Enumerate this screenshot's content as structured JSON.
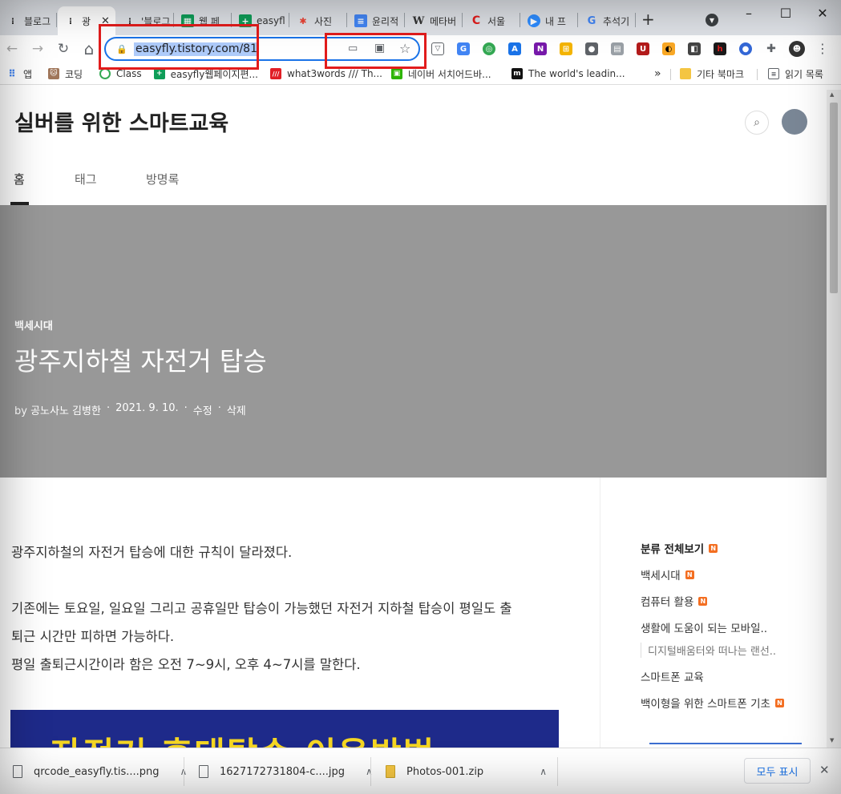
{
  "tabs": [
    {
      "label": "블로그",
      "icon": "tistory-icon"
    },
    {
      "label": "광",
      "icon": "tistory-icon",
      "active": true
    },
    {
      "label": "'블로그",
      "icon": "tistory-icon"
    },
    {
      "label": "웹 페",
      "icon": "sheet-icon"
    },
    {
      "label": "easyfl",
      "icon": "sheet-icon"
    },
    {
      "label": "사진",
      "icon": "photos-icon"
    },
    {
      "label": "윤리적",
      "icon": "docs-icon"
    },
    {
      "label": "메타버",
      "icon": "wikipedia-icon"
    },
    {
      "label": "서울",
      "icon": "red-c-icon"
    },
    {
      "label": "내 프",
      "icon": "zoom-icon"
    },
    {
      "label": "추석기",
      "icon": "google-icon"
    }
  ],
  "new_tab_label": "+",
  "window": {
    "minimize": "–",
    "maximize": "☐",
    "close": "✕"
  },
  "toolbar": {
    "back": "←",
    "forward": "→",
    "reload": "↻",
    "home": "⌂"
  },
  "omnibox": {
    "url": "easyfly.tistory.com/81"
  },
  "bookmarks": [
    {
      "label": "앱",
      "icon": "apps-icon"
    },
    {
      "label": "코딩",
      "icon": "cat-icon"
    },
    {
      "label": "Class",
      "icon": "class-icon"
    },
    {
      "label": "easyfly웹페이지편...",
      "icon": "sheet-icon"
    },
    {
      "label": "what3words /// Th...",
      "icon": "w3w-icon"
    },
    {
      "label": "네이버 서치어드바...",
      "icon": "naver-icon"
    },
    {
      "label": "The world's leadin...",
      "icon": "m-icon"
    }
  ],
  "bookmarks_more": "»",
  "bookmarks_other": "기타 북마크",
  "bookmarks_reading": "읽기 목록",
  "blog": {
    "title": "실버를 위한 스마트교육",
    "nav": [
      "홈",
      "태그",
      "방명록"
    ]
  },
  "post": {
    "category": "백세시대",
    "title": "광주지하철 자전거 탑승",
    "meta_by": "by 공노사노 김병한",
    "meta_date": "2021. 9. 10.",
    "meta_edit": "수정",
    "meta_delete": "삭제",
    "meta_sep": "·",
    "para1": "광주지하철의 자전거 탑승에 대한 규칙이 달라졌다.",
    "para2a": "기존에는 토요일, 일요일 그리고 공휴일만 탑승이 가능했던 자전거 지하철 탑승이 평일도 출",
    "para2b": "퇴근 시간만 피하면 가능하다.",
    "para3": "평일 출퇴근시간이라 함은 오전 7~9시, 오후 4~7시를 말한다.",
    "image_text": "자전거 휴대탑승 이용방법"
  },
  "sidebar": {
    "heading": "분류 전체보기",
    "items": [
      {
        "label": "백세시대",
        "new": true
      },
      {
        "label": "컴퓨터 활용",
        "new": true
      },
      {
        "label": "생활에 도움이 되는 모바일..",
        "new": false
      },
      {
        "label": "디지털배움터와 떠나는 랜선..",
        "new": false,
        "sub": true
      },
      {
        "label": "스마트폰 교육",
        "new": false
      },
      {
        "label": "백이형을 위한 스마트폰 기초",
        "new": true
      }
    ],
    "new_badge": "N"
  },
  "downloads": [
    {
      "file": "qrcode_easyfly.tis....png"
    },
    {
      "file": "1627172731804-c....jpg"
    },
    {
      "file": "Photos-001.zip"
    }
  ],
  "downloads_show_all": "모두 표시",
  "downloads_close": "✕",
  "colors": {
    "accent": "#1a73e8",
    "hero": "#989898",
    "badge": "#f36e21",
    "highlight": "#e21c1c"
  }
}
